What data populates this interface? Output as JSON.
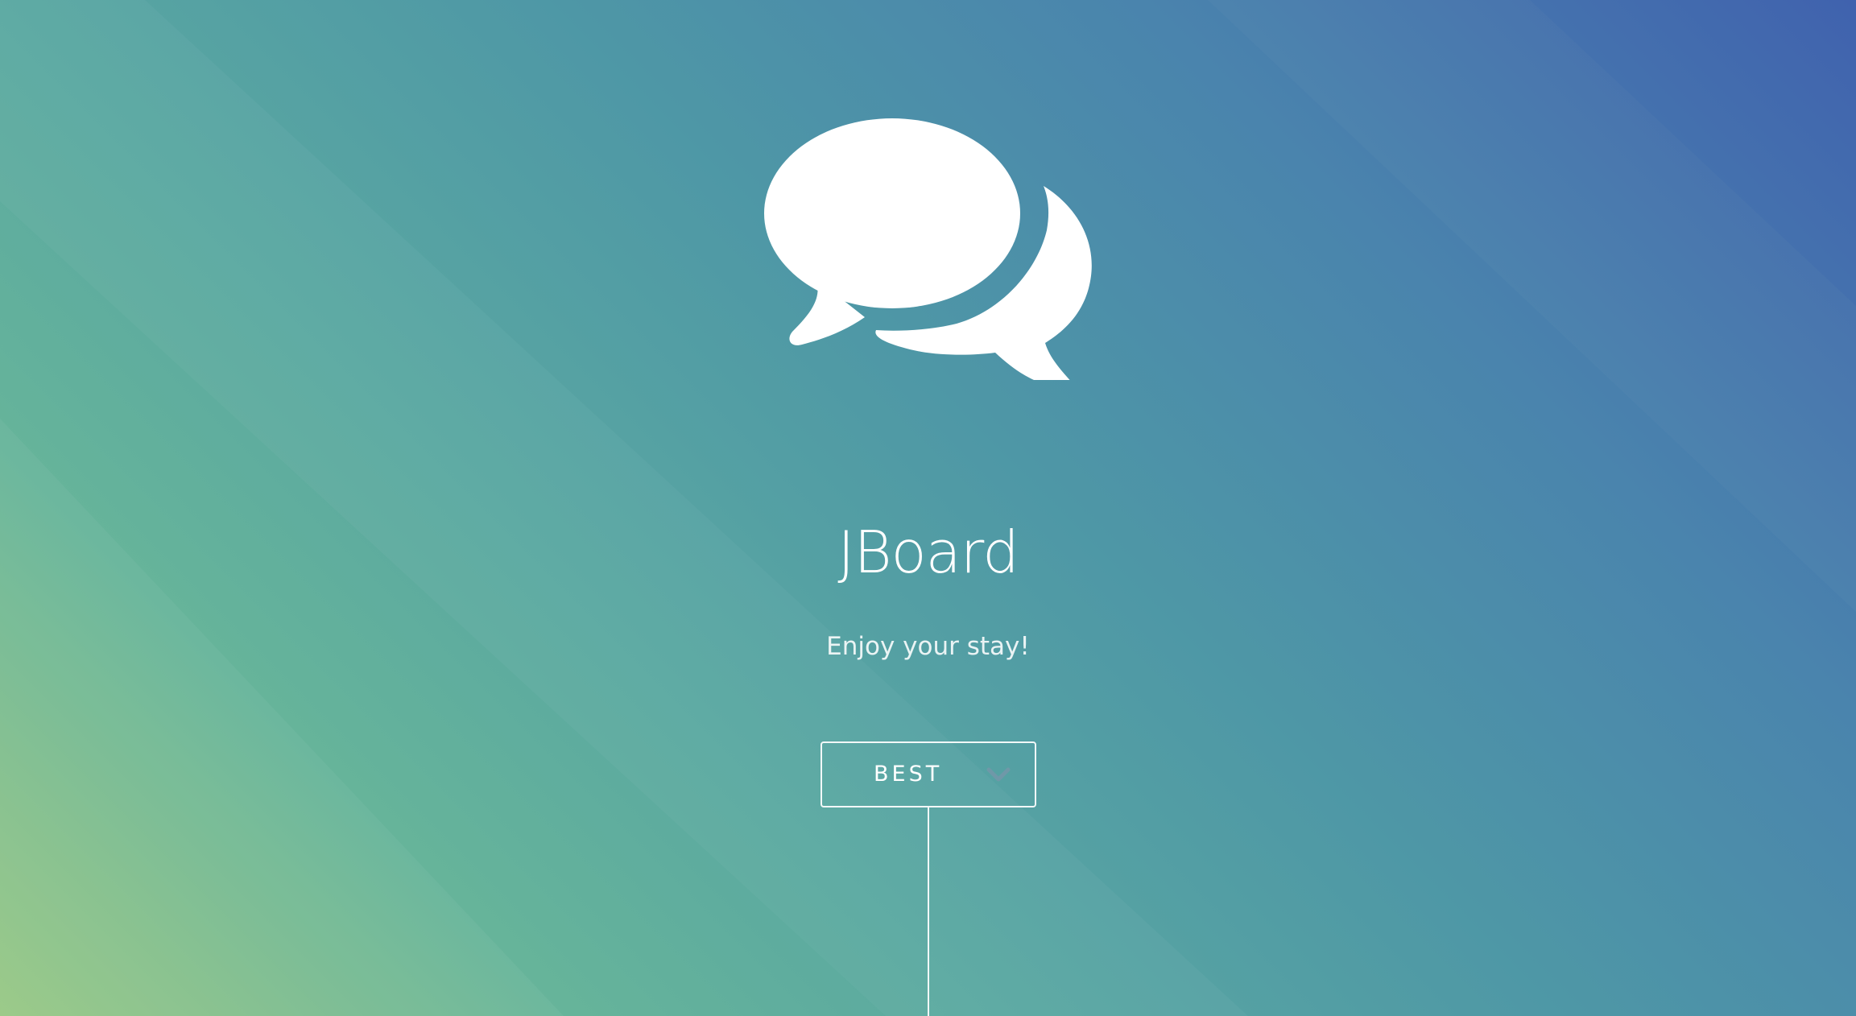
{
  "app": {
    "title": "JBoard",
    "tagline": "Enjoy your stay!"
  },
  "icons": {
    "logo": "chat-bubbles-icon",
    "dropdown": "chevron-down-icon"
  },
  "sort": {
    "selected": "BEST"
  },
  "colors": {
    "gradient_top_right": "#4062ae",
    "gradient_mid": "#4e97a6",
    "gradient_bottom_left": "#98c884",
    "text": "#ffffff"
  }
}
